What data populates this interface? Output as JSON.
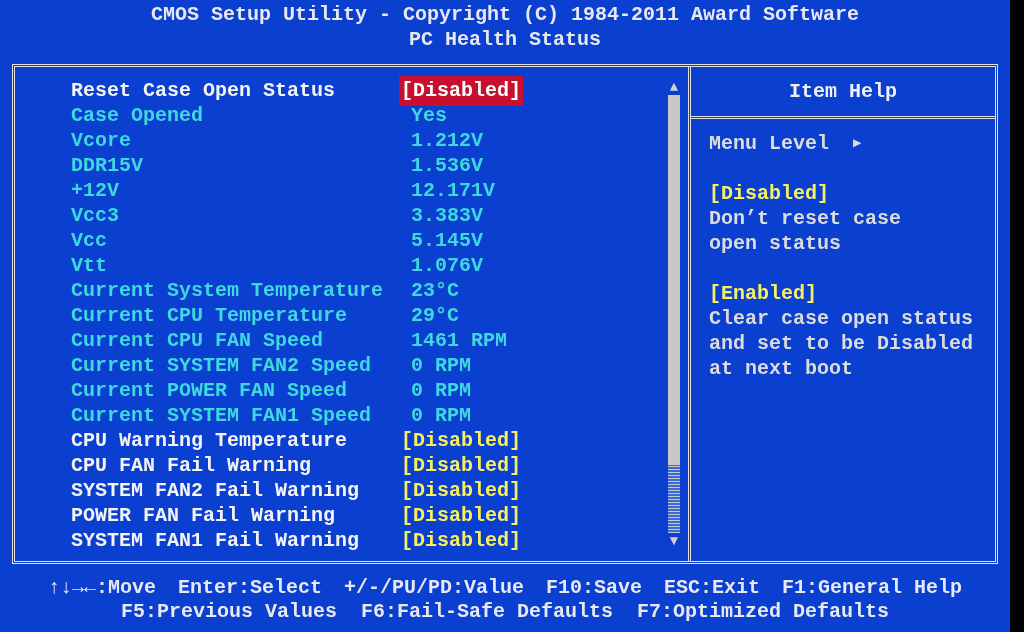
{
  "header": {
    "title": "CMOS Setup Utility - Copyright (C) 1984-2011 Award Software",
    "subtitle": "PC Health Status"
  },
  "items": [
    {
      "kind": "setting",
      "label": "Reset Case Open Status",
      "value": "[Disabled]",
      "selected": true
    },
    {
      "kind": "reading",
      "label": "Case Opened",
      "value": "Yes"
    },
    {
      "kind": "reading",
      "label": "Vcore",
      "value": "1.212V"
    },
    {
      "kind": "reading",
      "label": "DDR15V",
      "value": "1.536V"
    },
    {
      "kind": "reading",
      "label": "+12V",
      "value": "12.171V"
    },
    {
      "kind": "reading",
      "label": "Vcc3",
      "value": "3.383V"
    },
    {
      "kind": "reading",
      "label": "Vcc",
      "value": "5.145V"
    },
    {
      "kind": "reading",
      "label": "Vtt",
      "value": "1.076V"
    },
    {
      "kind": "reading",
      "label": "Current System Temperature",
      "value": "23°C"
    },
    {
      "kind": "reading",
      "label": "Current CPU Temperature",
      "value": "29°C"
    },
    {
      "kind": "reading",
      "label": "Current CPU FAN Speed",
      "value": "1461 RPM"
    },
    {
      "kind": "reading",
      "label": "Current SYSTEM FAN2 Speed",
      "value": "0 RPM"
    },
    {
      "kind": "reading",
      "label": "Current POWER FAN Speed",
      "value": "0 RPM"
    },
    {
      "kind": "reading",
      "label": "Current SYSTEM FAN1 Speed",
      "value": "0 RPM"
    },
    {
      "kind": "setting",
      "label": "CPU Warning Temperature",
      "value": "[Disabled]",
      "selected": false
    },
    {
      "kind": "setting",
      "label": "CPU FAN Fail Warning",
      "value": "[Disabled]",
      "selected": false
    },
    {
      "kind": "setting",
      "label": "SYSTEM FAN2 Fail Warning",
      "value": "[Disabled]",
      "selected": false
    },
    {
      "kind": "setting",
      "label": "POWER FAN Fail Warning",
      "value": "[Disabled]",
      "selected": false
    },
    {
      "kind": "setting",
      "label": "SYSTEM FAN1 Fail Warning",
      "value": "[Disabled]",
      "selected": false
    }
  ],
  "scroll_arrows": {
    "up": "▲",
    "down": "▼"
  },
  "help": {
    "title": "Item Help",
    "menu_level": "Menu Level",
    "menu_level_marker": "▶",
    "options": [
      {
        "name": "[Disabled]",
        "description_lines": [
          "Don’t reset case",
          "open status"
        ]
      },
      {
        "name": "[Enabled]",
        "description_lines": [
          "Clear case open status",
          "and set to be Disabled",
          "at next boot"
        ]
      }
    ]
  },
  "footer": {
    "line_1": [
      "↑↓→←:Move",
      "Enter:Select",
      "+/-/PU/PD:Value",
      "F10:Save",
      "ESC:Exit",
      "F1:General Help"
    ],
    "line_2": [
      "F5:Previous Values",
      "F6:Fail-Safe Defaults",
      "F7:Optimized Defaults"
    ]
  }
}
